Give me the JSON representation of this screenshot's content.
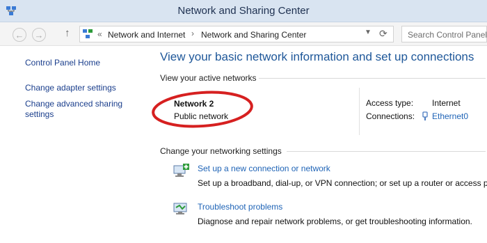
{
  "window": {
    "title": "Network and Sharing Center",
    "app_icon": "network-icon"
  },
  "nav": {
    "back_icon": "back-arrow-icon",
    "forward_icon": "forward-arrow-icon",
    "up_icon": "up-arrow-icon",
    "address_separator": "«",
    "breadcrumb": [
      "Network and Internet",
      "Network and Sharing Center"
    ],
    "search_placeholder": "Search Control Panel"
  },
  "sidebar": {
    "items": [
      {
        "label": "Control Panel Home"
      },
      {
        "label": "Change adapter settings"
      },
      {
        "label": "Change advanced sharing settings"
      }
    ]
  },
  "main": {
    "title": "View your basic network information and set up connections",
    "active_networks_label": "View your active networks",
    "network": {
      "name": "Network  2",
      "type": "Public network"
    },
    "access_type_label": "Access type:",
    "access_type_value": "Internet",
    "connections_label": "Connections:",
    "connections_value": "Ethernet0",
    "change_settings_label": "Change your networking settings",
    "tasks": [
      {
        "title": "Set up a new connection or network",
        "description": "Set up a broadband, dial-up, or VPN connection; or set up a router or access point.",
        "icon": "new-connection-icon"
      },
      {
        "title": "Troubleshoot problems",
        "description": "Diagnose and repair network problems, or get troubleshooting information.",
        "icon": "troubleshoot-icon"
      }
    ]
  },
  "colors": {
    "accent": "#1e5799",
    "link": "#1e63b6",
    "highlight_ring": "#d62020",
    "titlebar": "#d9e4f1"
  }
}
